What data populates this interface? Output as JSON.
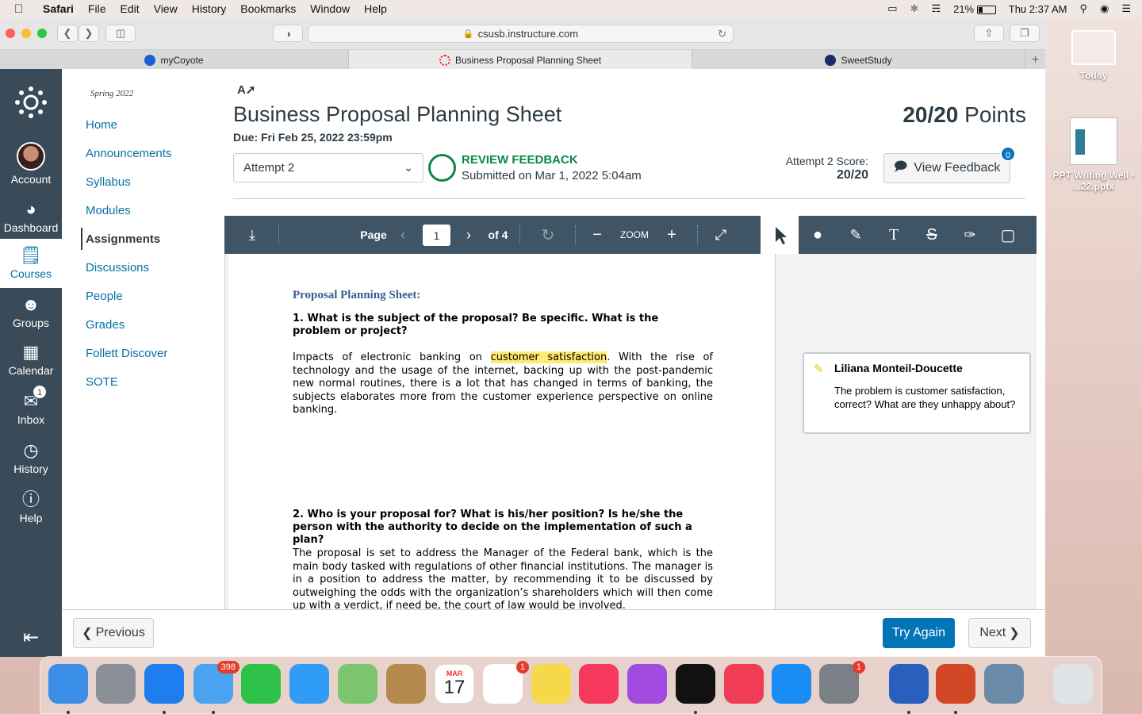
{
  "menubar": {
    "app": "Safari",
    "items": [
      "File",
      "Edit",
      "View",
      "History",
      "Bookmarks",
      "Window",
      "Help"
    ],
    "battery": "21%",
    "clock": "Thu 2:37 AM"
  },
  "browser": {
    "url": "csusb.instructure.com",
    "tabs": [
      {
        "label": "myCoyote",
        "color": "#1a5fd6"
      },
      {
        "label": "Business Proposal Planning Sheet",
        "color": "#e0301e"
      },
      {
        "label": "SweetStudy",
        "color": "#1b2a6b"
      }
    ]
  },
  "global_nav": {
    "items": [
      {
        "label": "Account",
        "icon": "avatar"
      },
      {
        "label": "Dashboard",
        "icon": "dashboard-icon"
      },
      {
        "label": "Courses",
        "icon": "courses-icon"
      },
      {
        "label": "Groups",
        "icon": "groups-icon"
      },
      {
        "label": "Calendar",
        "icon": "calendar-icon"
      },
      {
        "label": "Inbox",
        "icon": "inbox-icon",
        "badge": "1"
      },
      {
        "label": "History",
        "icon": "history-icon"
      },
      {
        "label": "Help",
        "icon": "help-icon"
      }
    ]
  },
  "course_nav": {
    "term": "Spring 2022",
    "items": [
      "Home",
      "Announcements",
      "Syllabus",
      "Modules",
      "Assignments",
      "Discussions",
      "People",
      "Grades",
      "Follett Discover",
      "SOTE"
    ],
    "active": "Assignments"
  },
  "assignment": {
    "title": "Business Proposal Planning Sheet",
    "points": "20/20",
    "points_label": "Points",
    "due": "Due: Fri Feb 25, 2022 23:59pm",
    "attempt": "Attempt 2",
    "status": "REVIEW FEEDBACK",
    "submitted": "Submitted on Mar 1, 2022 5:04am",
    "score_label": "Attempt 2 Score:",
    "score": "20/20",
    "view_feedback": "View Feedback",
    "feedback_count": "0"
  },
  "docviewer": {
    "page_label": "Page",
    "page": "1",
    "of": "of 4",
    "zoom": "ZOOM"
  },
  "document": {
    "heading": "Proposal Planning Sheet:",
    "q1": "1.  What is the subject of the proposal?  Be specific.  What is the problem or project?",
    "a1_pre": "Impacts of electronic banking on ",
    "a1_highlight": "customer satisfaction",
    "a1_post": ". With the rise of technology and the usage of the internet, backing up with the post-pandemic new normal routines, there is a lot that has changed in terms of banking, the subjects elaborates more from the customer experience perspective on online banking.",
    "q2": "2. Who is your proposal for?  What is his/her position?  Is he/she the person with the authority to decide on the implementation of such a plan?",
    "a2": "The proposal is set to address the Manager of the Federal bank, which is the main body tasked with regulations of other financial institutions. The manager is in a position to address the matter, by recommending it to be discussed by outweighing the odds with the organization’s shareholders which will then come up with a verdict, if need be, the court of law would be involved."
  },
  "comment": {
    "author": "Liliana Monteil-Doucette",
    "text": "The problem is customer satisfaction, correct? What are they unhappy about?"
  },
  "footer": {
    "previous": "Previous",
    "try_again": "Try Again",
    "next": "Next"
  },
  "desktop": {
    "icons": [
      {
        "label": "Today"
      },
      {
        "label": "PPT Writing Well - ...22.pptx"
      }
    ]
  },
  "dock": {
    "items": [
      {
        "name": "finder-icon",
        "color": "#3a8ee6"
      },
      {
        "name": "launchpad-icon",
        "color": "#8a8f98"
      },
      {
        "name": "safari-icon",
        "color": "#1e7ef0"
      },
      {
        "name": "mail-icon",
        "color": "#4aa3f0",
        "badge": "398"
      },
      {
        "name": "facetime-icon",
        "color": "#2fc24a"
      },
      {
        "name": "messages-icon",
        "color": "#2f9cf5"
      },
      {
        "name": "maps-icon",
        "color": "#7cc46d"
      },
      {
        "name": "contacts-icon",
        "color": "#b68a4e"
      },
      {
        "name": "calendar-icon",
        "color": "#ffffff",
        "text": "17",
        "sub": "MAR"
      },
      {
        "name": "reminders-icon",
        "color": "#ffffff",
        "badge": "1"
      },
      {
        "name": "notes-icon",
        "color": "#f5d94a"
      },
      {
        "name": "music-icon",
        "color": "#f5385c"
      },
      {
        "name": "podcasts-icon",
        "color": "#a24be0"
      },
      {
        "name": "tv-icon",
        "color": "#111111"
      },
      {
        "name": "news-icon",
        "color": "#f03c54"
      },
      {
        "name": "app-store-icon",
        "color": "#1a8cf5"
      },
      {
        "name": "system-preferences-icon",
        "color": "#7b7f86",
        "badge": "1"
      },
      {
        "name": "word-icon",
        "color": "#2b5fbd"
      },
      {
        "name": "powerpoint-icon",
        "color": "#d24726"
      },
      {
        "name": "preview-icon",
        "color": "#6a8ba8"
      },
      {
        "name": "trash-icon",
        "color": "#dfe3e6"
      }
    ]
  }
}
